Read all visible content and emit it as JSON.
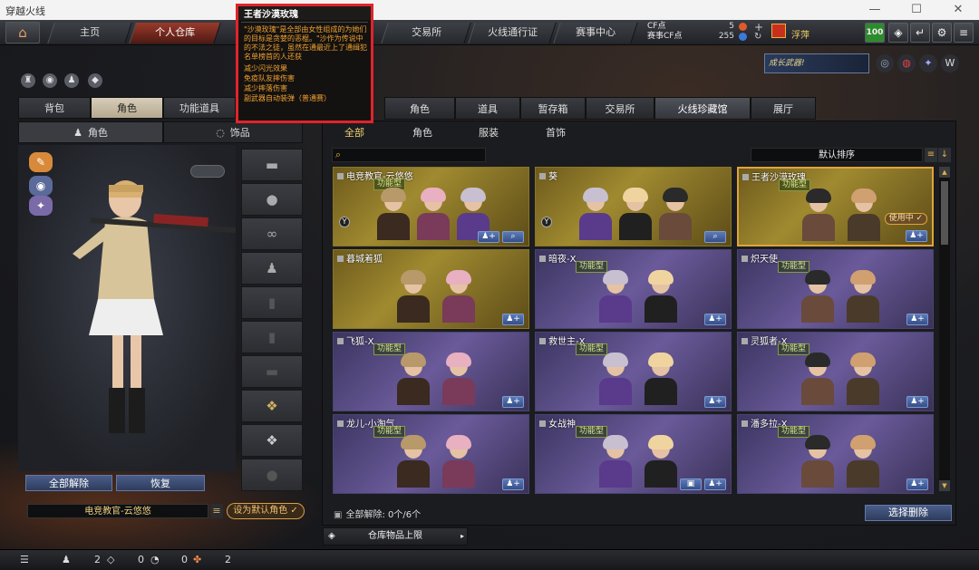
{
  "window": {
    "title": "穿越火线"
  },
  "nav": {
    "tabs": [
      {
        "label": "主页"
      },
      {
        "label": "个人仓库"
      },
      {
        "label": "交易所"
      },
      {
        "label": "火线通行证"
      },
      {
        "label": "赛事中心"
      }
    ],
    "active_tab": "个人仓库"
  },
  "currency": {
    "cf_label": "CF点",
    "cf_value": "5",
    "event_label": "赛事CF点",
    "event_value": "255"
  },
  "user": {
    "name": "浮萍",
    "level": "100"
  },
  "banner": {
    "text": "成长武器!"
  },
  "tooltip": {
    "title": "王者沙漠玫瑰",
    "description": "\"沙漠玫瑰\"是全部由女性组成的为她们的目标是贪婪的恶棍。\"沙作为传说中的不法之徒，虽然在通最近上了通缉犯名单榜首的人还获",
    "attributes": [
      "减少闪光效果",
      "免疫队友摔伤害",
      "减少摔落伤害",
      "副武器自动装弹（普通赛）"
    ]
  },
  "left_panel": {
    "tabs": [
      {
        "label": "背包"
      },
      {
        "label": "角色"
      },
      {
        "label": "功能道具"
      }
    ],
    "sub_tabs": [
      {
        "label": "角色"
      },
      {
        "label": "饰品"
      }
    ],
    "buttons": {
      "clear_all": "全部解除",
      "restore": "恢复"
    },
    "current_character": "电竞教官-云悠悠",
    "set_default": "设为默认角色"
  },
  "right_panel": {
    "tabs": [
      {
        "label": "角色"
      },
      {
        "label": "道具"
      },
      {
        "label": "暂存箱"
      },
      {
        "label": "交易所"
      },
      {
        "label": "火线珍藏馆"
      },
      {
        "label": "展厅"
      }
    ],
    "filters": [
      {
        "label": "全部"
      },
      {
        "label": "角色"
      },
      {
        "label": "服装"
      },
      {
        "label": "首饰"
      }
    ],
    "sort_label": "默认排序",
    "type_label": "功能型",
    "in_use_label": "使用中",
    "cards": [
      {
        "name": "电竞教官-云悠悠",
        "style": "gold",
        "type": true
      },
      {
        "name": "葵",
        "style": "gold",
        "type": false
      },
      {
        "name": "王者沙漠玫瑰",
        "style": "gold",
        "type": true,
        "selected": true
      },
      {
        "name": "暮城着狐",
        "style": "gold",
        "type": false
      },
      {
        "name": "暗夜-X",
        "style": "purple",
        "type": true
      },
      {
        "name": "炽天使",
        "style": "purple",
        "type": true
      },
      {
        "name": "飞狐-X",
        "style": "purple",
        "type": true
      },
      {
        "name": "救世主-X",
        "style": "purple",
        "type": true
      },
      {
        "name": "灵狐者-X",
        "style": "purple",
        "type": true
      },
      {
        "name": "龙儿-小淘气",
        "style": "purple",
        "type": true
      },
      {
        "name": "女战神",
        "style": "purple",
        "type": true
      },
      {
        "name": "潘多拉-X",
        "style": "purple",
        "type": true
      }
    ],
    "clear_info": "全部解除: 0个/6个",
    "select_clear": "选择删除",
    "limit_label": "仓库物品上限"
  },
  "statusbar": {
    "count1": "2",
    "count2": "0",
    "count3": "0",
    "count4": "2"
  }
}
